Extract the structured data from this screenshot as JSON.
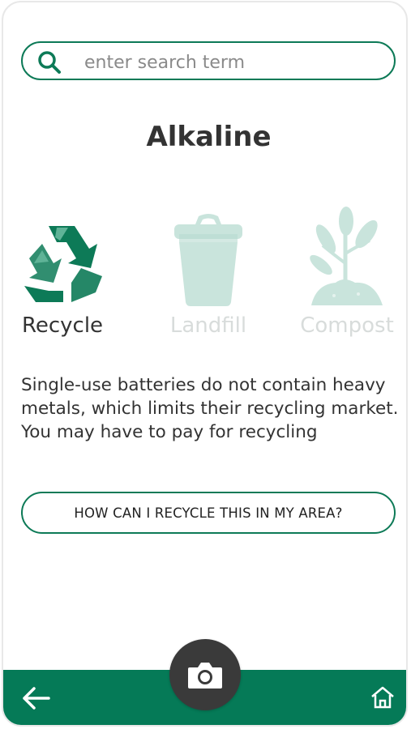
{
  "search": {
    "placeholder": "enter search term",
    "value": ""
  },
  "item": {
    "title": "Alkaline"
  },
  "categories": [
    {
      "label": "Recycle",
      "icon": "recycle-icon",
      "active": true
    },
    {
      "label": "Landfill",
      "icon": "trash-can-icon",
      "active": false
    },
    {
      "label": "Compost",
      "icon": "plant-icon",
      "active": false
    }
  ],
  "description": "Single-use batteries do not contain heavy metals, which limits their recycling market. You may have to pay for recycling",
  "cta": {
    "label": "HOW CAN I RECYCLE THIS IN MY AREA?"
  },
  "nav": {
    "back_icon": "arrow-left-icon",
    "home_icon": "home-icon",
    "camera_icon": "camera-icon"
  },
  "colors": {
    "brand": "#057a57",
    "active_icon": "#0d7a57",
    "inactive": "#c9e4dc",
    "camera_button": "#3a3a3a"
  }
}
